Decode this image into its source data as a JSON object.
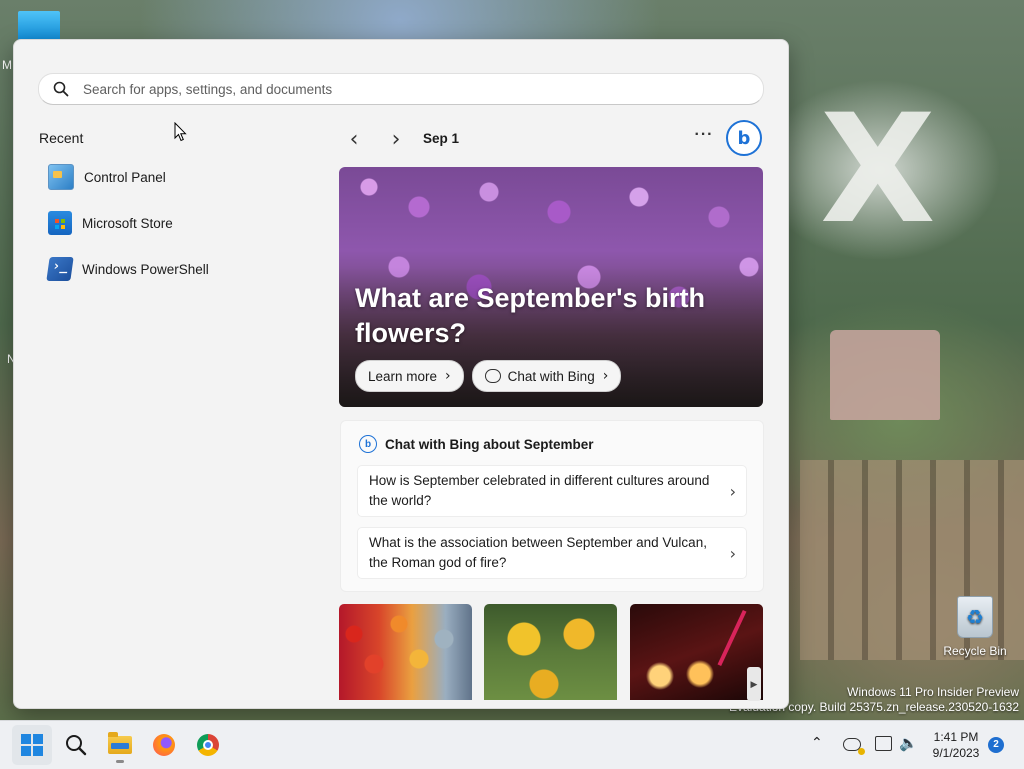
{
  "desktop": {
    "top_left_label": "M",
    "left_label_2": "N",
    "recycle_bin_label": "Recycle Bin",
    "watermark_line1": "Windows 11 Pro Insider Preview",
    "watermark_line2": "Evaluation copy. Build 25375.zn_release.230520-1632"
  },
  "start_menu": {
    "search": {
      "placeholder": "Search for apps, settings, and documents",
      "value": ""
    },
    "recent": {
      "title": "Recent",
      "items": [
        {
          "label": "Control Panel",
          "icon": "control-panel-icon"
        },
        {
          "label": "Microsoft Store",
          "icon": "store-icon"
        },
        {
          "label": "Windows PowerShell",
          "icon": "powershell-icon"
        }
      ]
    },
    "feed": {
      "date": "Sep 1",
      "hero": {
        "title": "What are September's birth flowers?",
        "learn_more": "Learn more",
        "chat_with_bing": "Chat with Bing"
      },
      "chat_card": {
        "title": "Chat with Bing about September",
        "suggestions": [
          "How is September celebrated in different cultures around the world?",
          "What is the association between September and Vulcan, the Roman god of fire?"
        ]
      }
    }
  },
  "taskbar": {
    "time": "1:41 PM",
    "date": "9/1/2023",
    "notification_count": "2"
  }
}
